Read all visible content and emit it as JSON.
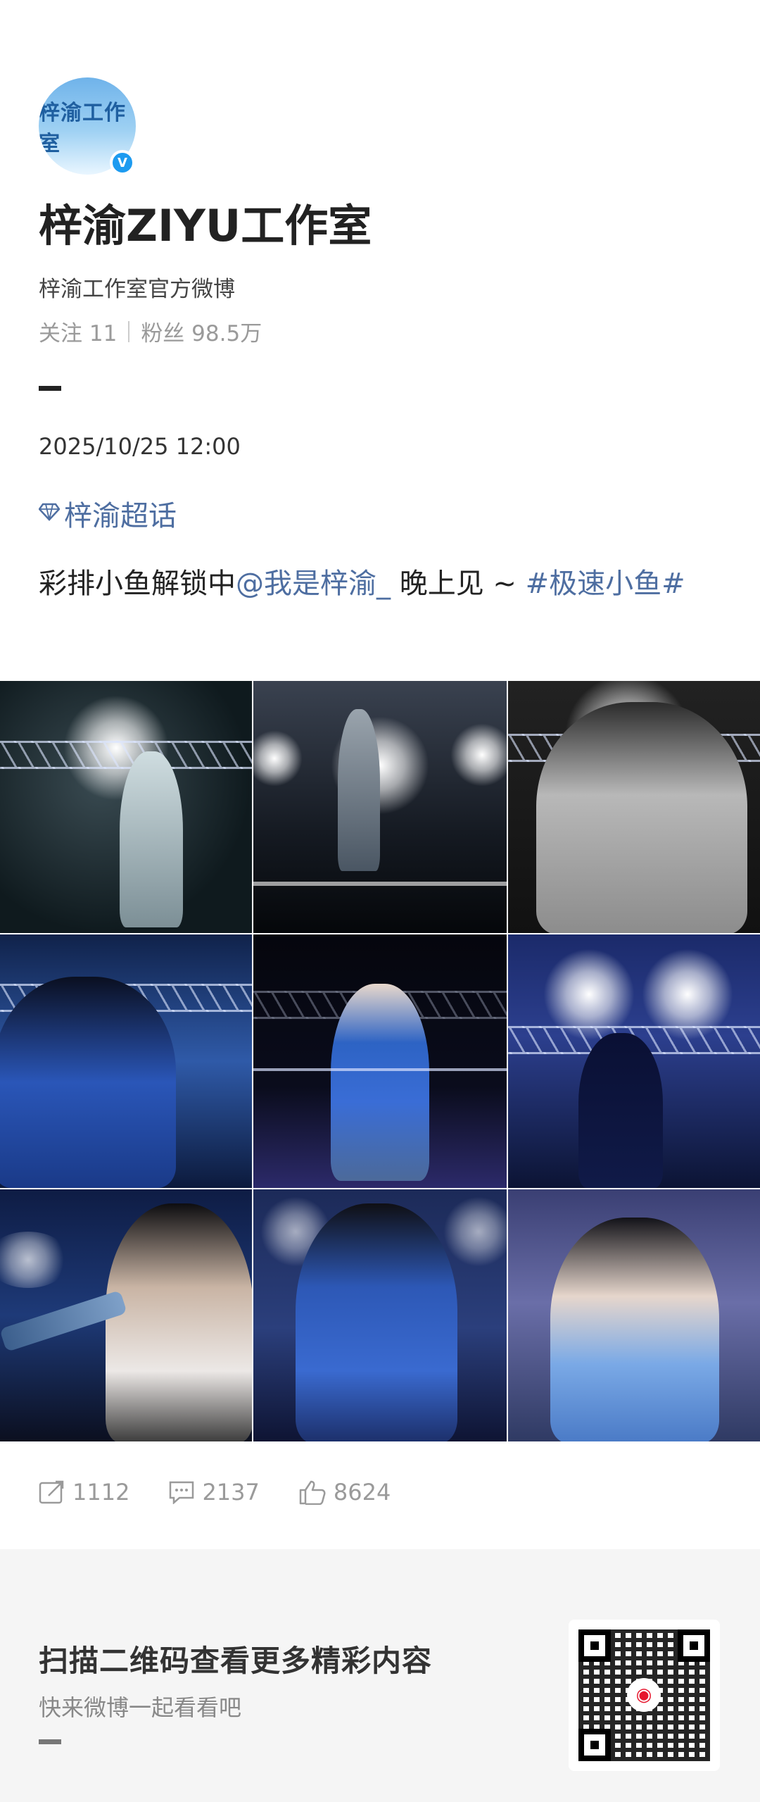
{
  "profile": {
    "avatar_text": "梓渝工作室",
    "verified_mark": "V",
    "name": "梓渝ZIYU工作室",
    "bio": "梓渝工作室官方微博",
    "follow_label": "关注 11",
    "fans_label": "粉丝 98.5万"
  },
  "post": {
    "timestamp": "2025/10/25 12:00",
    "topic": "梓渝超话",
    "text_before": "彩排小鱼解锁中",
    "mention": "@我是梓渝_",
    "text_after": " 晚上见 ~ ",
    "hashtag": "#极速小鱼#"
  },
  "photos": [
    {
      "name": "photo-1"
    },
    {
      "name": "photo-2"
    },
    {
      "name": "photo-3"
    },
    {
      "name": "photo-4"
    },
    {
      "name": "photo-5"
    },
    {
      "name": "photo-6"
    },
    {
      "name": "photo-7"
    },
    {
      "name": "photo-8"
    },
    {
      "name": "photo-9"
    }
  ],
  "actions": {
    "repost_count": "1112",
    "comment_count": "2137",
    "like_count": "8624"
  },
  "footer": {
    "title": "扫描二维码查看更多精彩内容",
    "subtitle": "快来微博一起看看吧"
  }
}
